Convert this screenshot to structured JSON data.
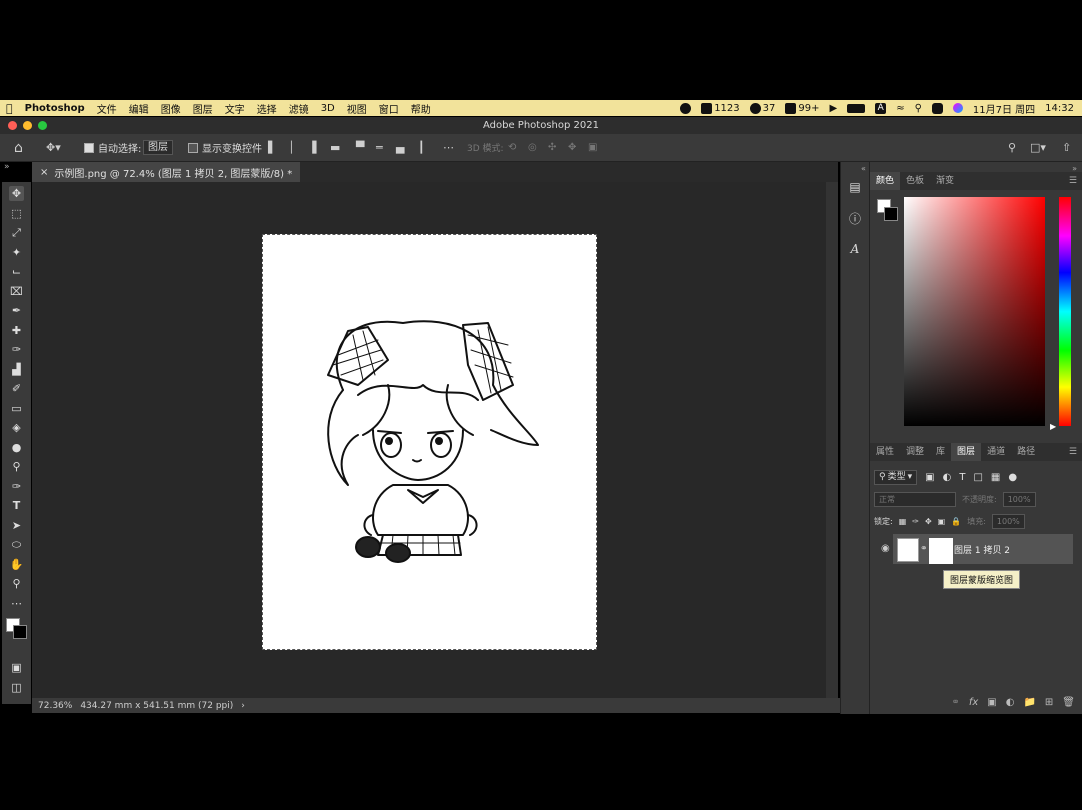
{
  "menubar": {
    "apple": "",
    "app_name": "Photoshop",
    "items": [
      "文件",
      "编辑",
      "图像",
      "图层",
      "文字",
      "选择",
      "滤镜",
      "3D",
      "视图",
      "窗口",
      "帮助"
    ],
    "tray": {
      "count1": "1123",
      "count2": "37",
      "count3": "99+",
      "input_method": "A",
      "date": "11月7日 周四",
      "time": "14:32"
    }
  },
  "window": {
    "title": "Adobe Photoshop 2021"
  },
  "options_bar": {
    "auto_select_label": "自动选择:",
    "auto_select_value": "图层",
    "show_transform_label": "显示变换控件",
    "mode_3d_label": "3D 模式:"
  },
  "document": {
    "tab_label": "示例图.png @ 72.4% (图层 1 拷贝 2, 图层蒙版/8) *",
    "zoom": "72.36%",
    "dimensions": "434.27 mm x 541.51 mm (72 ppi)"
  },
  "color_panel": {
    "tabs": [
      "颜色",
      "色板",
      "渐变"
    ],
    "active_tab": "颜色"
  },
  "layers_panel": {
    "tabs": [
      "属性",
      "调整",
      "库",
      "图层",
      "通道",
      "路径"
    ],
    "active_tab": "图层",
    "filter_kind": "类型",
    "blend_mode": "正常",
    "opacity_label": "不透明度:",
    "opacity_value": "100%",
    "lock_label": "锁定:",
    "fill_label": "填充:",
    "fill_value": "100%",
    "layers": [
      {
        "name": "图层 1 拷贝 2",
        "visible": true
      }
    ],
    "tooltip": "图层蒙版缩览图"
  },
  "colors": {
    "menubar_bg": "#f2e39b",
    "panel_bg": "#383838",
    "canvas_bg": "#282828",
    "close": "#ff5f57",
    "minimize": "#febc2e",
    "maximize": "#28c840"
  }
}
